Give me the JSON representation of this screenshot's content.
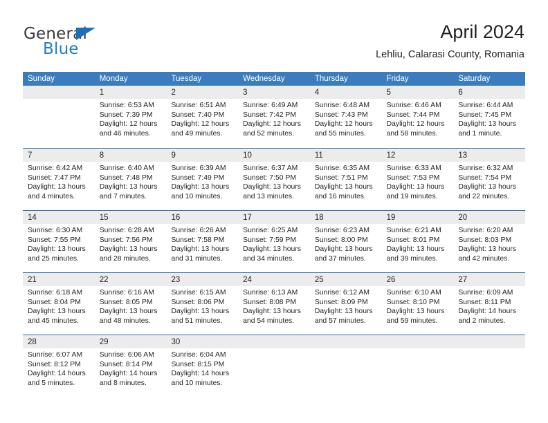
{
  "brand": {
    "name_top": "General",
    "name_bottom": "Blue",
    "triangle_color": "#1d6fb8",
    "blue_color": "#1d7ec4"
  },
  "header": {
    "title": "April 2024",
    "subtitle": "Lehliu, Calarasi County, Romania"
  },
  "theme": {
    "header_row_bg": "#3a7cbe",
    "row_divider": "#2f6da8",
    "daynum_band_bg": "#ececec",
    "text": "#231f20"
  },
  "calendar": {
    "weekdays": [
      "Sunday",
      "Monday",
      "Tuesday",
      "Wednesday",
      "Thursday",
      "Friday",
      "Saturday"
    ],
    "weeks": [
      [
        {
          "day": "",
          "lines": []
        },
        {
          "day": "1",
          "lines": [
            "Sunrise: 6:53 AM",
            "Sunset: 7:39 PM",
            "Daylight: 12 hours",
            "and 46 minutes."
          ]
        },
        {
          "day": "2",
          "lines": [
            "Sunrise: 6:51 AM",
            "Sunset: 7:40 PM",
            "Daylight: 12 hours",
            "and 49 minutes."
          ]
        },
        {
          "day": "3",
          "lines": [
            "Sunrise: 6:49 AM",
            "Sunset: 7:42 PM",
            "Daylight: 12 hours",
            "and 52 minutes."
          ]
        },
        {
          "day": "4",
          "lines": [
            "Sunrise: 6:48 AM",
            "Sunset: 7:43 PM",
            "Daylight: 12 hours",
            "and 55 minutes."
          ]
        },
        {
          "day": "5",
          "lines": [
            "Sunrise: 6:46 AM",
            "Sunset: 7:44 PM",
            "Daylight: 12 hours",
            "and 58 minutes."
          ]
        },
        {
          "day": "6",
          "lines": [
            "Sunrise: 6:44 AM",
            "Sunset: 7:45 PM",
            "Daylight: 13 hours",
            "and 1 minute."
          ]
        }
      ],
      [
        {
          "day": "7",
          "lines": [
            "Sunrise: 6:42 AM",
            "Sunset: 7:47 PM",
            "Daylight: 13 hours",
            "and 4 minutes."
          ]
        },
        {
          "day": "8",
          "lines": [
            "Sunrise: 6:40 AM",
            "Sunset: 7:48 PM",
            "Daylight: 13 hours",
            "and 7 minutes."
          ]
        },
        {
          "day": "9",
          "lines": [
            "Sunrise: 6:39 AM",
            "Sunset: 7:49 PM",
            "Daylight: 13 hours",
            "and 10 minutes."
          ]
        },
        {
          "day": "10",
          "lines": [
            "Sunrise: 6:37 AM",
            "Sunset: 7:50 PM",
            "Daylight: 13 hours",
            "and 13 minutes."
          ]
        },
        {
          "day": "11",
          "lines": [
            "Sunrise: 6:35 AM",
            "Sunset: 7:51 PM",
            "Daylight: 13 hours",
            "and 16 minutes."
          ]
        },
        {
          "day": "12",
          "lines": [
            "Sunrise: 6:33 AM",
            "Sunset: 7:53 PM",
            "Daylight: 13 hours",
            "and 19 minutes."
          ]
        },
        {
          "day": "13",
          "lines": [
            "Sunrise: 6:32 AM",
            "Sunset: 7:54 PM",
            "Daylight: 13 hours",
            "and 22 minutes."
          ]
        }
      ],
      [
        {
          "day": "14",
          "lines": [
            "Sunrise: 6:30 AM",
            "Sunset: 7:55 PM",
            "Daylight: 13 hours",
            "and 25 minutes."
          ]
        },
        {
          "day": "15",
          "lines": [
            "Sunrise: 6:28 AM",
            "Sunset: 7:56 PM",
            "Daylight: 13 hours",
            "and 28 minutes."
          ]
        },
        {
          "day": "16",
          "lines": [
            "Sunrise: 6:26 AM",
            "Sunset: 7:58 PM",
            "Daylight: 13 hours",
            "and 31 minutes."
          ]
        },
        {
          "day": "17",
          "lines": [
            "Sunrise: 6:25 AM",
            "Sunset: 7:59 PM",
            "Daylight: 13 hours",
            "and 34 minutes."
          ]
        },
        {
          "day": "18",
          "lines": [
            "Sunrise: 6:23 AM",
            "Sunset: 8:00 PM",
            "Daylight: 13 hours",
            "and 37 minutes."
          ]
        },
        {
          "day": "19",
          "lines": [
            "Sunrise: 6:21 AM",
            "Sunset: 8:01 PM",
            "Daylight: 13 hours",
            "and 39 minutes."
          ]
        },
        {
          "day": "20",
          "lines": [
            "Sunrise: 6:20 AM",
            "Sunset: 8:03 PM",
            "Daylight: 13 hours",
            "and 42 minutes."
          ]
        }
      ],
      [
        {
          "day": "21",
          "lines": [
            "Sunrise: 6:18 AM",
            "Sunset: 8:04 PM",
            "Daylight: 13 hours",
            "and 45 minutes."
          ]
        },
        {
          "day": "22",
          "lines": [
            "Sunrise: 6:16 AM",
            "Sunset: 8:05 PM",
            "Daylight: 13 hours",
            "and 48 minutes."
          ]
        },
        {
          "day": "23",
          "lines": [
            "Sunrise: 6:15 AM",
            "Sunset: 8:06 PM",
            "Daylight: 13 hours",
            "and 51 minutes."
          ]
        },
        {
          "day": "24",
          "lines": [
            "Sunrise: 6:13 AM",
            "Sunset: 8:08 PM",
            "Daylight: 13 hours",
            "and 54 minutes."
          ]
        },
        {
          "day": "25",
          "lines": [
            "Sunrise: 6:12 AM",
            "Sunset: 8:09 PM",
            "Daylight: 13 hours",
            "and 57 minutes."
          ]
        },
        {
          "day": "26",
          "lines": [
            "Sunrise: 6:10 AM",
            "Sunset: 8:10 PM",
            "Daylight: 13 hours",
            "and 59 minutes."
          ]
        },
        {
          "day": "27",
          "lines": [
            "Sunrise: 6:09 AM",
            "Sunset: 8:11 PM",
            "Daylight: 14 hours",
            "and 2 minutes."
          ]
        }
      ],
      [
        {
          "day": "28",
          "lines": [
            "Sunrise: 6:07 AM",
            "Sunset: 8:12 PM",
            "Daylight: 14 hours",
            "and 5 minutes."
          ]
        },
        {
          "day": "29",
          "lines": [
            "Sunrise: 6:06 AM",
            "Sunset: 8:14 PM",
            "Daylight: 14 hours",
            "and 8 minutes."
          ]
        },
        {
          "day": "30",
          "lines": [
            "Sunrise: 6:04 AM",
            "Sunset: 8:15 PM",
            "Daylight: 14 hours",
            "and 10 minutes."
          ]
        },
        {
          "day": "",
          "lines": []
        },
        {
          "day": "",
          "lines": []
        },
        {
          "day": "",
          "lines": []
        },
        {
          "day": "",
          "lines": []
        }
      ]
    ]
  }
}
